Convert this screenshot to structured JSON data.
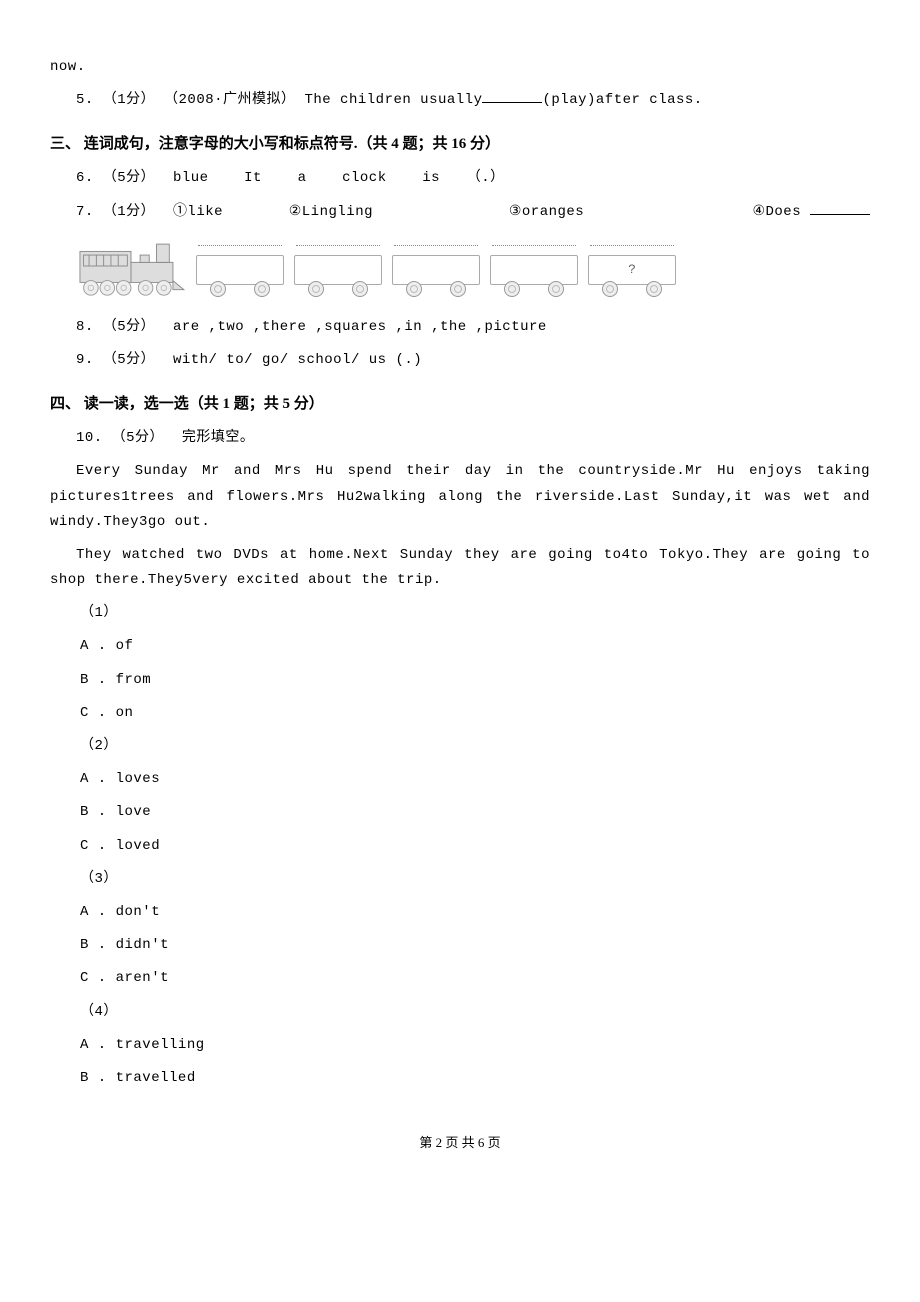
{
  "hanging": "now.",
  "q5": {
    "num": "5.",
    "pts": "（1分）",
    "year": "（2008·广州模拟）",
    "before": "The children usually",
    "after": "(play)after class."
  },
  "section3": {
    "title": "三、 连词成句，注意字母的大小写和标点符号.（共 4 题；共 16 分）",
    "q6": {
      "num": "6.",
      "pts": "（5分）",
      "w1": "blue",
      "w2": "It",
      "w3": "a",
      "w4": "clock",
      "w5": "is",
      "w6": "（.）"
    },
    "q7": {
      "num": "7.",
      "pts": "（1分）",
      "w1": "①like",
      "w2": "②Lingling",
      "w3": "③oranges",
      "w4": "④Does"
    },
    "wagon_last": "?",
    "q8": {
      "num": "8.",
      "pts": "（5分）",
      "words": "are ,two ,there ,squares ,in ,the ,picture"
    },
    "q9": {
      "num": "9.",
      "pts": "（5分）",
      "words": "with/ to/ go/ school/ us (.)"
    }
  },
  "section4": {
    "title": "四、 读一读，选一选（共 1 题；共 5 分）",
    "q10": {
      "num": "10.",
      "pts": "（5分）",
      "type": "完形填空。",
      "p1": "Every Sunday Mr and Mrs Hu spend their day in the countryside.Mr Hu enjoys taking pictures1trees and flowers.Mrs Hu2walking along the riverside.Last Sunday,it was wet and windy.They3go out.",
      "p2": "They watched two DVDs at home.Next Sunday they are going to4to Tokyo.They are going to shop there.They5very excited about the trip.",
      "groups": [
        {
          "n": "（1）",
          "a": "A . of",
          "b": "B . from",
          "c": "C . on"
        },
        {
          "n": "（2）",
          "a": "A . loves",
          "b": "B . love",
          "c": "C . loved"
        },
        {
          "n": "（3）",
          "a": "A . don't",
          "b": "B . didn't",
          "c": "C . aren't"
        },
        {
          "n": "（4）",
          "a": "A . travelling",
          "b": "B . travelled"
        }
      ]
    }
  },
  "footer": "第 2 页 共 6 页"
}
